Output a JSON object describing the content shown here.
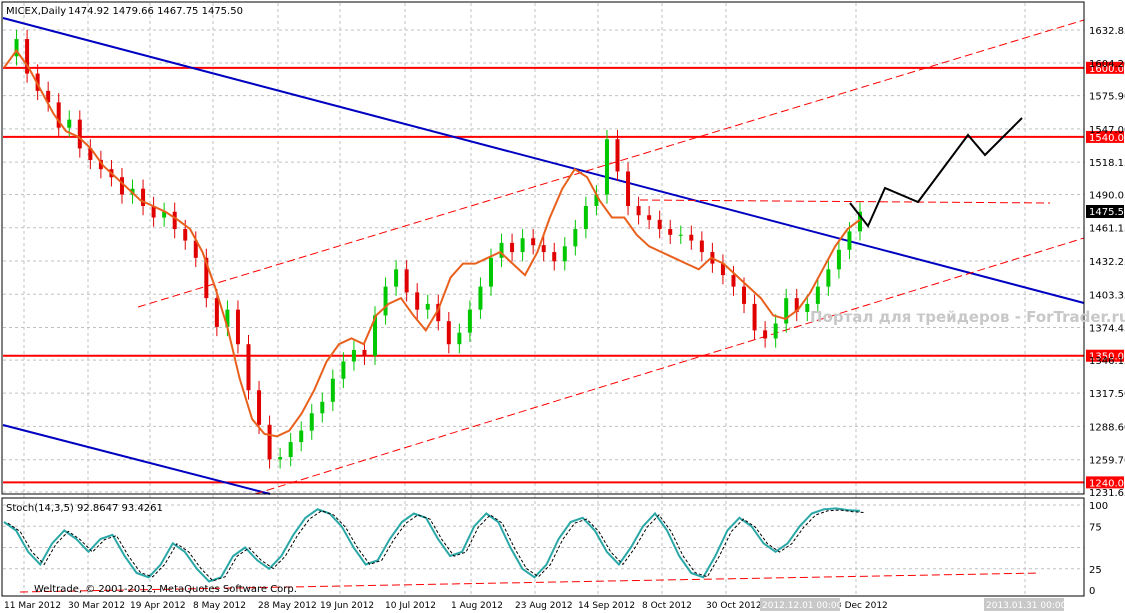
{
  "header": {
    "instrument": "MICEX,Daily",
    "ohlc": "1474.92 1479.66 1467.75 1475.50"
  },
  "stoch_header": "Stoch(14,3,5) 92.8647 93.4261",
  "copyright": "Weltrade, © 2001-2012, MetaQuotes Software Corp.",
  "watermark": "Портал для трейдеров - ForTrader.ru",
  "current_price_label": "1475.50",
  "date_label_1": "2012.12.01 00:00",
  "date_label_2": "2013.01.31 00:00",
  "colors": {
    "bull": "#00c800",
    "bear": "#e00000",
    "ma": "#e8601c",
    "channel": "#0000c0",
    "level": "#ff0000",
    "stoch_main": "#2aa7a7",
    "forecast": "#000000"
  },
  "chart_data": {
    "type": "line",
    "title": "MICEX,Daily",
    "instrument": "MICEX",
    "timeframe": "Daily",
    "last_ohlc": {
      "open": 1474.92,
      "high": 1479.66,
      "low": 1467.75,
      "close": 1475.5
    },
    "y_ticks": [
      "1632.85",
      "1604.20",
      "1575.90",
      "1547.00",
      "1518.15",
      "1490.05",
      "1461.15",
      "1432.25",
      "1403.35",
      "1374.45",
      "1346.15",
      "1317.50",
      "1288.60",
      "1259.70",
      "1231.65"
    ],
    "x_ticks": [
      "11 Mar 2012",
      "30 Mar 2012",
      "19 Apr 2012",
      "8 May 2012",
      "28 May 2012",
      "19 Jun 2012",
      "10 Jul 2012",
      "1 Aug 2012",
      "23 Aug 2012",
      "14 Sep 2012",
      "8 Oct 2012",
      "30 Oct 2012",
      "3 Dec 2012"
    ],
    "horizontal_levels": [
      1600.0,
      1540.0,
      1350.0,
      1240.0
    ],
    "level_labels": [
      "1600.00",
      "1540.00",
      "1350.00",
      "1240.00"
    ],
    "close_series": [
      1610,
      1625,
      1595,
      1580,
      1570,
      1548,
      1555,
      1530,
      1520,
      1512,
      1505,
      1490,
      1495,
      1480,
      1470,
      1475,
      1460,
      1450,
      1435,
      1400,
      1375,
      1390,
      1360,
      1320,
      1290,
      1260,
      1262,
      1275,
      1285,
      1300,
      1310,
      1330,
      1345,
      1355,
      1350,
      1385,
      1410,
      1425,
      1405,
      1390,
      1395,
      1380,
      1360,
      1370,
      1390,
      1410,
      1435,
      1448,
      1440,
      1452,
      1446,
      1440,
      1432,
      1445,
      1460,
      1480,
      1490,
      1538,
      1510,
      1480,
      1472,
      1468,
      1460,
      1455,
      1455,
      1450,
      1440,
      1430,
      1420,
      1410,
      1395,
      1372,
      1365,
      1378,
      1400,
      1388,
      1395,
      1410,
      1425,
      1442,
      1458,
      1475
    ],
    "ma_series": [
      1600,
      1615,
      1600,
      1580,
      1560,
      1545,
      1540,
      1530,
      1515,
      1505,
      1495,
      1485,
      1480,
      1475,
      1468,
      1460,
      1440,
      1410,
      1375,
      1330,
      1295,
      1282,
      1280,
      1285,
      1300,
      1320,
      1345,
      1360,
      1365,
      1360,
      1385,
      1395,
      1400,
      1385,
      1372,
      1390,
      1418,
      1430,
      1430,
      1435,
      1440,
      1430,
      1420,
      1440,
      1470,
      1495,
      1512,
      1505,
      1485,
      1470,
      1470,
      1455,
      1445,
      1440,
      1435,
      1430,
      1425,
      1435,
      1430,
      1420,
      1410,
      1400,
      1385,
      1382,
      1390,
      1405,
      1425,
      1445,
      1460,
      1468
    ],
    "stochastic": {
      "name": "Stoch(14,3,5)",
      "main": 92.8647,
      "signal": 93.4261,
      "levels": [
        25,
        50,
        75,
        100
      ],
      "y_ticks": [
        "100",
        "75",
        "25",
        "0"
      ],
      "main_series": [
        80,
        70,
        45,
        30,
        55,
        70,
        60,
        45,
        60,
        65,
        40,
        20,
        15,
        30,
        55,
        45,
        25,
        10,
        15,
        40,
        50,
        35,
        25,
        40,
        65,
        85,
        95,
        90,
        75,
        50,
        30,
        35,
        60,
        80,
        90,
        85,
        60,
        40,
        45,
        75,
        90,
        80,
        50,
        25,
        15,
        30,
        60,
        80,
        85,
        70,
        45,
        30,
        50,
        75,
        90,
        70,
        40,
        20,
        15,
        40,
        70,
        85,
        75,
        55,
        45,
        55,
        75,
        90,
        95,
        96,
        94,
        93
      ],
      "forecast_note": "black projection line"
    }
  }
}
